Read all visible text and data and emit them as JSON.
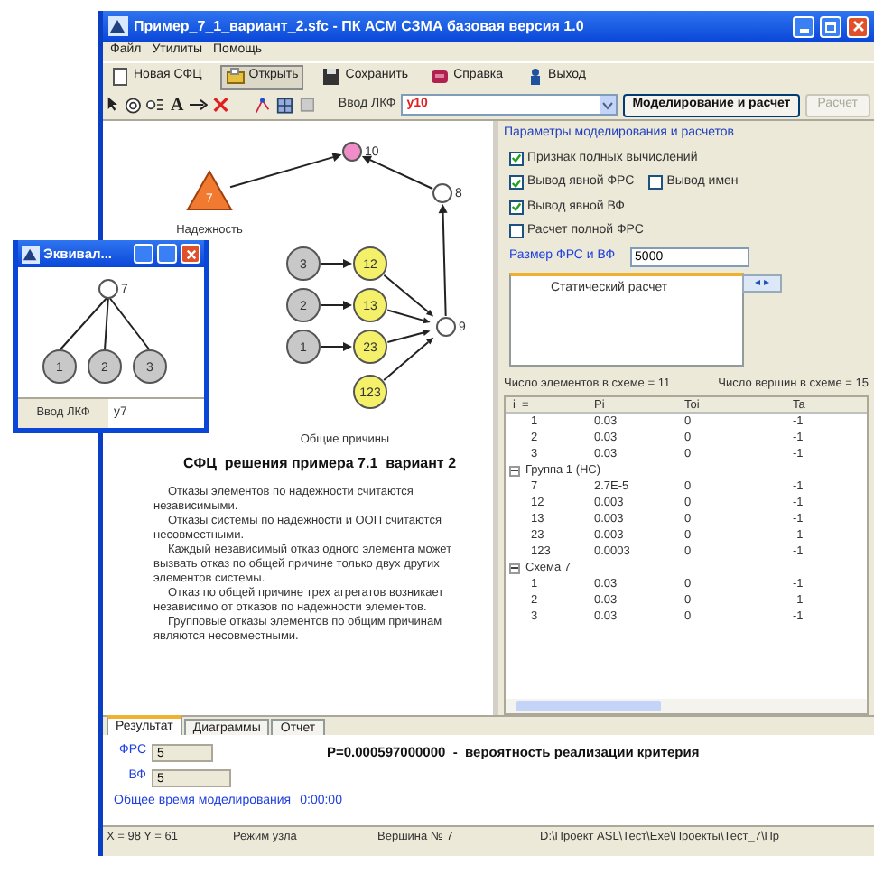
{
  "window": {
    "title": "Пример_7_1_вариант_2.sfc - ПК АСМ СЗМА базовая версия 1.0"
  },
  "menu": [
    "Файл",
    "Утилиты",
    "Помощь"
  ],
  "toolbar": [
    {
      "label": "Новая СФЦ",
      "kind": "new",
      "pressed": false
    },
    {
      "label": "Открыть",
      "kind": "open",
      "pressed": true
    },
    {
      "label": "Сохранить",
      "kind": "save",
      "pressed": false
    },
    {
      "label": "Справка",
      "kind": "help",
      "pressed": false
    },
    {
      "label": "Выход",
      "kind": "exit",
      "pressed": false
    }
  ],
  "tools": {
    "text_tool": "A",
    "lkf_label": "Ввод ЛКФ",
    "lkf_value": "y10",
    "run_button": "Моделирование и расчет",
    "calc_button": {
      "label": "Расчет",
      "disabled": true
    }
  },
  "diagram": {
    "nodes": [
      {
        "label": "10",
        "kind": "pink"
      },
      {
        "label": "7",
        "kind": "triangle"
      },
      {
        "label": "8",
        "kind": "white"
      },
      {
        "label": "9",
        "kind": "white"
      },
      {
        "label": "3",
        "kind": "gray"
      },
      {
        "label": "2",
        "kind": "gray"
      },
      {
        "label": "1",
        "kind": "gray"
      },
      {
        "label": "12",
        "kind": "yellow"
      },
      {
        "label": "13",
        "kind": "yellow"
      },
      {
        "label": "23",
        "kind": "yellow"
      },
      {
        "label": "123",
        "kind": "yellow"
      }
    ],
    "captions": [
      "Надежность",
      "Общие причины"
    ],
    "title": "СФЦ  решения примера 7.1  вариант 2",
    "notes": [
      "Отказы элементов по надежности считаются независимыми.",
      "Отказы системы по надежности и ООП считаются несовместными.",
      "Каждый независимый отказ одного элемента может вызвать отказ по общей причине только двух других элементов системы.",
      "Отказ по общей причине трех агрегатов возникает независимо от отказов по надежности элементов.",
      "Групповые отказы элементов по общим причинам являются несовместными."
    ]
  },
  "params": {
    "title": "Параметры моделирования и расчетов",
    "checks": [
      [
        {
          "label": "Признак полных вычислений",
          "checked": true
        }
      ],
      [
        {
          "label": "Вывод явной ФРС",
          "checked": true
        },
        {
          "label": "Вывод имен",
          "checked": false
        }
      ],
      [
        {
          "label": "Вывод явной ВФ",
          "checked": true
        }
      ],
      [
        {
          "label": "Расчет полной ФРС",
          "checked": false
        }
      ]
    ],
    "size_label": "Размер ФРС и ВФ",
    "size_value": "5000",
    "tab": "Статический расчет",
    "tab_arrows": "◂ ▸"
  },
  "counts": [
    "Число элементов в схеме = 11",
    "Число вершин в схеме = 15"
  ],
  "table": {
    "columns": [
      "i  =",
      "Pi",
      "Toi",
      "Ta"
    ],
    "rows": [
      {
        "cells": [
          "1",
          "0.03",
          "0",
          "-1"
        ]
      },
      {
        "cells": [
          "2",
          "0.03",
          "0",
          "-1"
        ]
      },
      {
        "cells": [
          "3",
          "0.03",
          "0",
          "-1"
        ]
      },
      {
        "group": "Группа 1 (НС)",
        "expanded": true,
        "children": [
          {
            "cells": [
              "7",
              "2.7E-5",
              "0",
              "-1"
            ]
          },
          {
            "cells": [
              "12",
              "0.003",
              "0",
              "-1"
            ]
          },
          {
            "cells": [
              "13",
              "0.003",
              "0",
              "-1"
            ]
          },
          {
            "cells": [
              "23",
              "0.003",
              "0",
              "-1"
            ]
          },
          {
            "cells": [
              "123",
              "0.0003",
              "0",
              "-1"
            ]
          }
        ]
      },
      {
        "group": "Схема 7",
        "expanded": true,
        "children": [
          {
            "cells": [
              "1",
              "0.03",
              "0",
              "-1"
            ]
          },
          {
            "cells": [
              "2",
              "0.03",
              "0",
              "-1"
            ]
          },
          {
            "cells": [
              "3",
              "0.03",
              "0",
              "-1"
            ]
          }
        ]
      }
    ]
  },
  "bottom_tabs": [
    {
      "label": "Результат",
      "selected": true
    },
    {
      "label": "Диаграммы",
      "selected": false
    },
    {
      "label": "Отчет",
      "selected": false
    }
  ],
  "result": {
    "frs_label": "ФРС",
    "frs_value": "5",
    "vf_label": "ВФ",
    "vf_value": "5",
    "probability": "P=0.000597000000  -  вероятность реализации критерия",
    "time_label": "Общее время моделирования",
    "time_value": "0:00:00"
  },
  "status_bar": [
    "X = 98 Y = 61",
    "Режим узла",
    "Вершина № 7",
    "D:\\Проект ASL\\Тест\\Exe\\Проекты\\Тест_7\\Пр"
  ],
  "subwindow": {
    "title": "Эквивал...",
    "nodes": [
      {
        "label": "7",
        "kind": "white"
      },
      {
        "label": "1",
        "kind": "gray"
      },
      {
        "label": "2",
        "kind": "gray"
      },
      {
        "label": "3",
        "kind": "gray"
      }
    ],
    "lkf_label": "Ввод ЛКФ",
    "lkf_value": "y7"
  }
}
